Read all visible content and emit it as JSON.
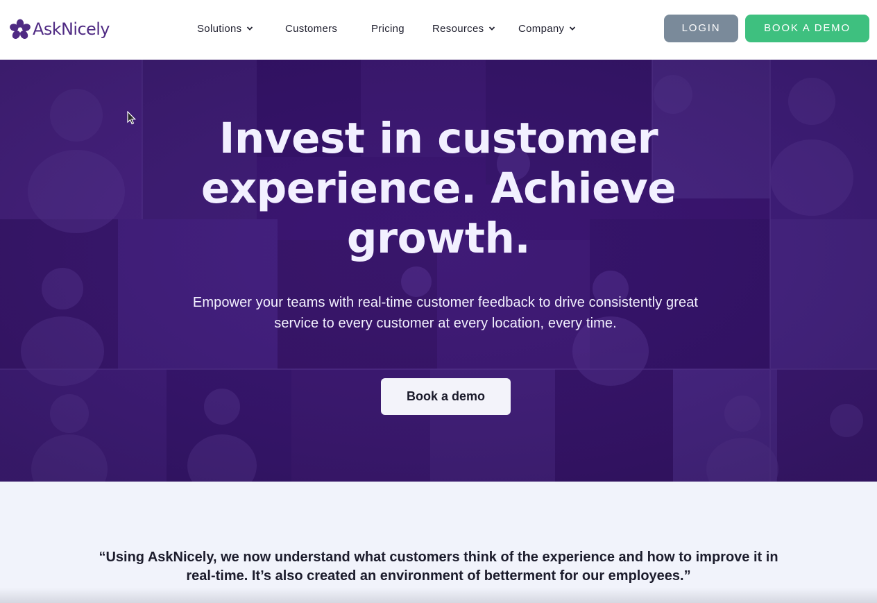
{
  "brand": {
    "name": "AskNicely",
    "accent": "#4f2a83"
  },
  "nav": {
    "items": [
      {
        "label": "Solutions",
        "dropdown": true
      },
      {
        "label": "Customers",
        "dropdown": false
      },
      {
        "label": "Pricing",
        "dropdown": false
      },
      {
        "label": "Resources",
        "dropdown": true
      },
      {
        "label": "Company",
        "dropdown": true
      }
    ],
    "login_label": "LOGIN",
    "demo_label": "BOOK A DEMO"
  },
  "hero": {
    "title": "Invest in customer experience. Achieve growth.",
    "subtitle": "Empower your teams with real-time customer feedback to drive consistently great service to every customer at every location, every time.",
    "cta_label": "Book a demo",
    "overlay_color": "#3a1670"
  },
  "testimonial": {
    "quote": "“Using AskNicely, we now understand what customers think of the experience and how to improve it in real-time. It’s also created an environment of betterment for our employees.”"
  },
  "colors": {
    "login_bg": "#7a8a9a",
    "demo_bg": "#3ec07f",
    "page_bg": "#f1f3fb"
  }
}
